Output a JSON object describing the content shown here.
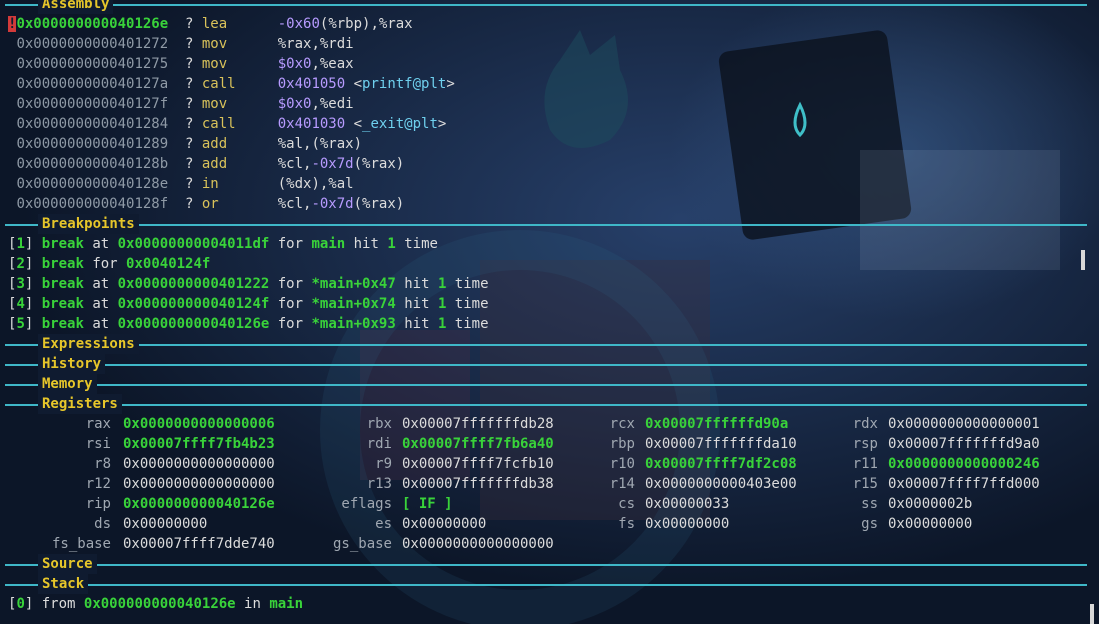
{
  "sections": {
    "assembly": "Assembly",
    "breakpoints": "Breakpoints",
    "expressions": "Expressions",
    "history": "History",
    "memory": "Memory",
    "registers": "Registers",
    "source": "Source",
    "stack": "Stack"
  },
  "assembly": [
    {
      "marker": "!",
      "addr": "0x000000000040126e",
      "q": "?",
      "mnem": "lea",
      "ops": [
        {
          "t": "-0x60",
          "c": "num"
        },
        {
          "t": "(%rbp),%rax",
          "c": "plain"
        }
      ],
      "current": true
    },
    {
      "addr": "0x0000000000401272",
      "q": "?",
      "mnem": "mov",
      "ops": [
        {
          "t": "%rax,%rdi",
          "c": "plain"
        }
      ]
    },
    {
      "addr": "0x0000000000401275",
      "q": "?",
      "mnem": "mov",
      "ops": [
        {
          "t": "$0x0",
          "c": "num"
        },
        {
          "t": ",%eax",
          "c": "plain"
        }
      ]
    },
    {
      "addr": "0x000000000040127a",
      "q": "?",
      "mnem": "call",
      "ops": [
        {
          "t": "0x401050",
          "c": "num"
        },
        {
          "t": " <",
          "c": "plain"
        },
        {
          "t": "printf@plt",
          "c": "sym"
        },
        {
          "t": ">",
          "c": "plain"
        }
      ]
    },
    {
      "addr": "0x000000000040127f",
      "q": "?",
      "mnem": "mov",
      "ops": [
        {
          "t": "$0x0",
          "c": "num"
        },
        {
          "t": ",%edi",
          "c": "plain"
        }
      ]
    },
    {
      "addr": "0x0000000000401284",
      "q": "?",
      "mnem": "call",
      "ops": [
        {
          "t": "0x401030",
          "c": "num"
        },
        {
          "t": " <",
          "c": "plain"
        },
        {
          "t": "_exit@plt",
          "c": "sym"
        },
        {
          "t": ">",
          "c": "plain"
        }
      ]
    },
    {
      "addr": "0x0000000000401289",
      "q": "?",
      "mnem": "add",
      "ops": [
        {
          "t": "%al,(%rax)",
          "c": "plain"
        }
      ]
    },
    {
      "addr": "0x000000000040128b",
      "q": "?",
      "mnem": "add",
      "ops": [
        {
          "t": "%cl,",
          "c": "plain"
        },
        {
          "t": "-0x7d",
          "c": "num"
        },
        {
          "t": "(%rax)",
          "c": "plain"
        }
      ]
    },
    {
      "addr": "0x000000000040128e",
      "q": "?",
      "mnem": "in",
      "ops": [
        {
          "t": "(%dx),%al",
          "c": "plain"
        }
      ]
    },
    {
      "addr": "0x000000000040128f",
      "q": "?",
      "mnem": "or",
      "ops": [
        {
          "t": "%cl,",
          "c": "plain"
        },
        {
          "t": "-0x7d",
          "c": "num"
        },
        {
          "t": "(%rax)",
          "c": "plain"
        }
      ]
    }
  ],
  "breakpoints": [
    [
      {
        "t": "[",
        "c": "plain"
      },
      {
        "t": "1",
        "c": "green"
      },
      {
        "t": "] ",
        "c": "plain"
      },
      {
        "t": "break",
        "c": "kw"
      },
      {
        "t": " at ",
        "c": "plain"
      },
      {
        "t": "0x00000000004011df",
        "c": "green"
      },
      {
        "t": " for ",
        "c": "plain"
      },
      {
        "t": "main",
        "c": "green"
      },
      {
        "t": " hit ",
        "c": "plain"
      },
      {
        "t": "1",
        "c": "green"
      },
      {
        "t": " time",
        "c": "plain"
      }
    ],
    [
      {
        "t": "[",
        "c": "plain"
      },
      {
        "t": "2",
        "c": "green"
      },
      {
        "t": "] ",
        "c": "plain"
      },
      {
        "t": "break",
        "c": "kw"
      },
      {
        "t": " for ",
        "c": "plain"
      },
      {
        "t": "0x0040124f",
        "c": "green"
      }
    ],
    [
      {
        "t": "[",
        "c": "plain"
      },
      {
        "t": "3",
        "c": "green"
      },
      {
        "t": "] ",
        "c": "plain"
      },
      {
        "t": "break",
        "c": "kw"
      },
      {
        "t": " at ",
        "c": "plain"
      },
      {
        "t": "0x0000000000401222",
        "c": "green"
      },
      {
        "t": " for ",
        "c": "plain"
      },
      {
        "t": "*main+0x47",
        "c": "green"
      },
      {
        "t": " hit ",
        "c": "plain"
      },
      {
        "t": "1",
        "c": "green"
      },
      {
        "t": " time",
        "c": "plain"
      }
    ],
    [
      {
        "t": "[",
        "c": "plain"
      },
      {
        "t": "4",
        "c": "green"
      },
      {
        "t": "] ",
        "c": "plain"
      },
      {
        "t": "break",
        "c": "kw"
      },
      {
        "t": " at ",
        "c": "plain"
      },
      {
        "t": "0x000000000040124f",
        "c": "green"
      },
      {
        "t": " for ",
        "c": "plain"
      },
      {
        "t": "*main+0x74",
        "c": "green"
      },
      {
        "t": " hit ",
        "c": "plain"
      },
      {
        "t": "1",
        "c": "green"
      },
      {
        "t": " time",
        "c": "plain"
      }
    ],
    [
      {
        "t": "[",
        "c": "plain"
      },
      {
        "t": "5",
        "c": "green"
      },
      {
        "t": "] ",
        "c": "plain"
      },
      {
        "t": "break",
        "c": "kw"
      },
      {
        "t": " at ",
        "c": "plain"
      },
      {
        "t": "0x000000000040126e",
        "c": "green"
      },
      {
        "t": " for ",
        "c": "plain"
      },
      {
        "t": "*main+0x93",
        "c": "green"
      },
      {
        "t": " hit ",
        "c": "plain"
      },
      {
        "t": "1",
        "c": "green"
      },
      {
        "t": " time",
        "c": "plain"
      }
    ]
  ],
  "registers": [
    [
      {
        "n": "rax",
        "v": "0x0000000000000006",
        "changed": true
      },
      {
        "n": "rbx",
        "v": "0x00007fffffffdb28"
      },
      {
        "n": "rcx",
        "v": "0x00007ffffffd90a",
        "changed": true
      },
      {
        "n": "rdx",
        "v": "0x0000000000000001"
      }
    ],
    [
      {
        "n": "rsi",
        "v": "0x00007ffff7fb4b23",
        "changed": true
      },
      {
        "n": "rdi",
        "v": "0x00007ffff7fb6a40",
        "changed": true
      },
      {
        "n": "rbp",
        "v": "0x00007fffffffda10"
      },
      {
        "n": "rsp",
        "v": "0x00007fffffffd9a0"
      }
    ],
    [
      {
        "n": "r8",
        "v": "0x0000000000000000"
      },
      {
        "n": "r9",
        "v": "0x00007ffff7fcfb10"
      },
      {
        "n": "r10",
        "v": "0x00007ffff7df2c08",
        "changed": true
      },
      {
        "n": "r11",
        "v": "0x0000000000000246",
        "changed": true
      }
    ],
    [
      {
        "n": "r12",
        "v": "0x0000000000000000"
      },
      {
        "n": "r13",
        "v": "0x00007fffffffdb38"
      },
      {
        "n": "r14",
        "v": "0x0000000000403e00"
      },
      {
        "n": "r15",
        "v": "0x00007ffff7ffd000"
      }
    ],
    [
      {
        "n": "rip",
        "v": "0x000000000040126e",
        "changed": true
      },
      {
        "n": "eflags",
        "v": "[ IF ]",
        "changed": true
      },
      {
        "n": "cs",
        "v": "0x00000033"
      },
      {
        "n": "ss",
        "v": "0x0000002b"
      }
    ],
    [
      {
        "n": "ds",
        "v": "0x00000000"
      },
      {
        "n": "es",
        "v": "0x00000000"
      },
      {
        "n": "fs",
        "v": "0x00000000"
      },
      {
        "n": "gs",
        "v": "0x00000000"
      }
    ],
    [
      {
        "n": "fs_base",
        "v": "0x00007ffff7dde740"
      },
      {
        "n": "gs_base",
        "v": "0x0000000000000000"
      }
    ]
  ],
  "stack": [
    [
      {
        "t": "[",
        "c": "plain"
      },
      {
        "t": "0",
        "c": "green"
      },
      {
        "t": "] from ",
        "c": "plain"
      },
      {
        "t": "0x000000000040126e",
        "c": "green"
      },
      {
        "t": " in ",
        "c": "plain"
      },
      {
        "t": "main",
        "c": "green"
      }
    ]
  ],
  "colors": {
    "rule": "#3fb7c8",
    "title": "#e6c62a",
    "green": "#39d33a",
    "number": "#b79bff",
    "symbol": "#6fd0ee",
    "mnemonic": "#d9c25a"
  }
}
